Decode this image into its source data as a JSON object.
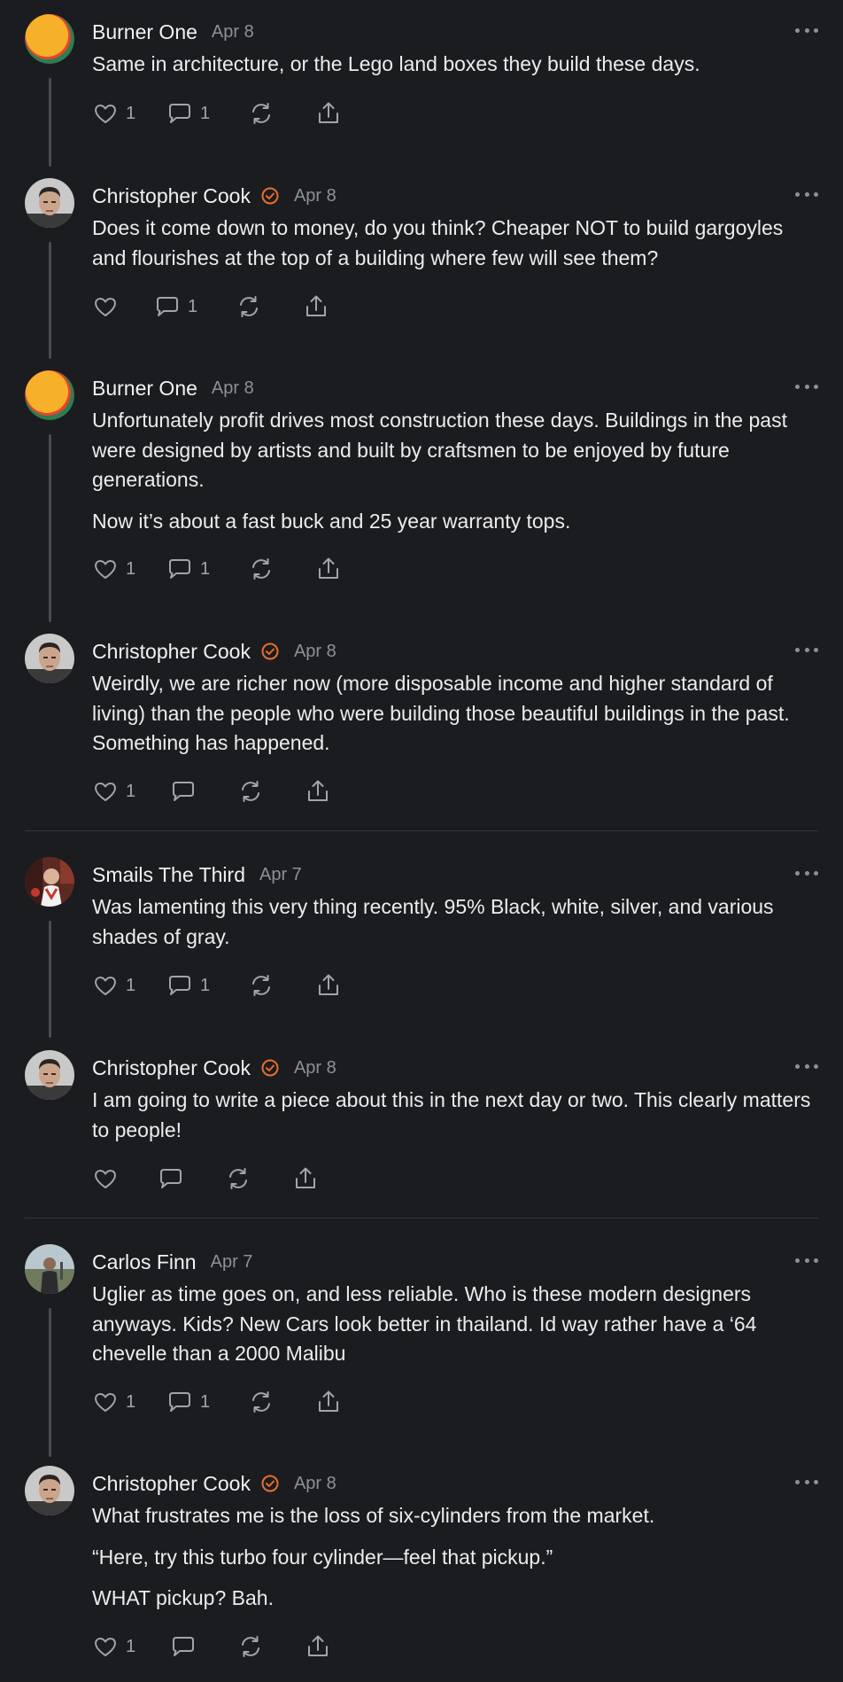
{
  "comments": [
    {
      "author": "Burner One",
      "verified": false,
      "date": "Apr 8",
      "avatar": "orange-circle-avatar",
      "paragraphs": [
        "Same in architecture, or the Lego land boxes they build these days."
      ],
      "likes": "1",
      "replies": "1"
    },
    {
      "author": "Christopher Cook",
      "verified": true,
      "date": "Apr 8",
      "avatar": "man-portrait-avatar",
      "paragraphs": [
        "Does it come down to money, do you think? Cheaper NOT to build gargoyles and flourishes at the top of a building where few will see them?"
      ],
      "likes": "",
      "replies": "1"
    },
    {
      "author": "Burner One",
      "verified": false,
      "date": "Apr 8",
      "avatar": "orange-circle-avatar",
      "paragraphs": [
        "Unfortunately profit drives most construction these days. Buildings in the past were designed by artists and built by craftsmen to be enjoyed by future generations.",
        "Now it’s about a fast buck and 25 year warranty tops."
      ],
      "likes": "1",
      "replies": "1"
    },
    {
      "author": "Christopher Cook",
      "verified": true,
      "date": "Apr 8",
      "avatar": "man-portrait-avatar",
      "paragraphs": [
        "Weirdly, we are richer now (more disposable income and higher standard of living) than the people who were building those beautiful buildings in the past. Something has happened."
      ],
      "likes": "1",
      "replies": ""
    },
    {
      "author": "Smails The Third",
      "verified": false,
      "date": "Apr 7",
      "avatar": "red-figure-avatar",
      "paragraphs": [
        "Was lamenting this very thing recently. 95% Black, white, silver, and various shades of gray."
      ],
      "likes": "1",
      "replies": "1"
    },
    {
      "author": "Christopher Cook",
      "verified": true,
      "date": "Apr 8",
      "avatar": "man-portrait-avatar",
      "paragraphs": [
        "I am going to write a piece about this in the next day or two. This clearly matters to people!"
      ],
      "likes": "",
      "replies": ""
    },
    {
      "author": "Carlos Finn",
      "verified": false,
      "date": "Apr 7",
      "avatar": "man-outdoor-avatar",
      "paragraphs": [
        "Uglier as time goes on, and less reliable. Who is these modern designers anyways. Kids? New Cars look better in thailand. Id way rather have a ‘64 chevelle than a 2000 Malibu"
      ],
      "likes": "1",
      "replies": "1"
    },
    {
      "author": "Christopher Cook",
      "verified": true,
      "date": "Apr 8",
      "avatar": "man-portrait-avatar",
      "paragraphs": [
        "What frustrates me is the loss of six-cylinders from the market.",
        "“Here, try this turbo four cylinder—feel that pickup.”",
        "WHAT pickup? Bah."
      ],
      "likes": "1",
      "replies": ""
    }
  ],
  "colors": {
    "background": "#1b1c1f",
    "verified_badge": "#e8702a",
    "muted_text": "#8f9096"
  }
}
